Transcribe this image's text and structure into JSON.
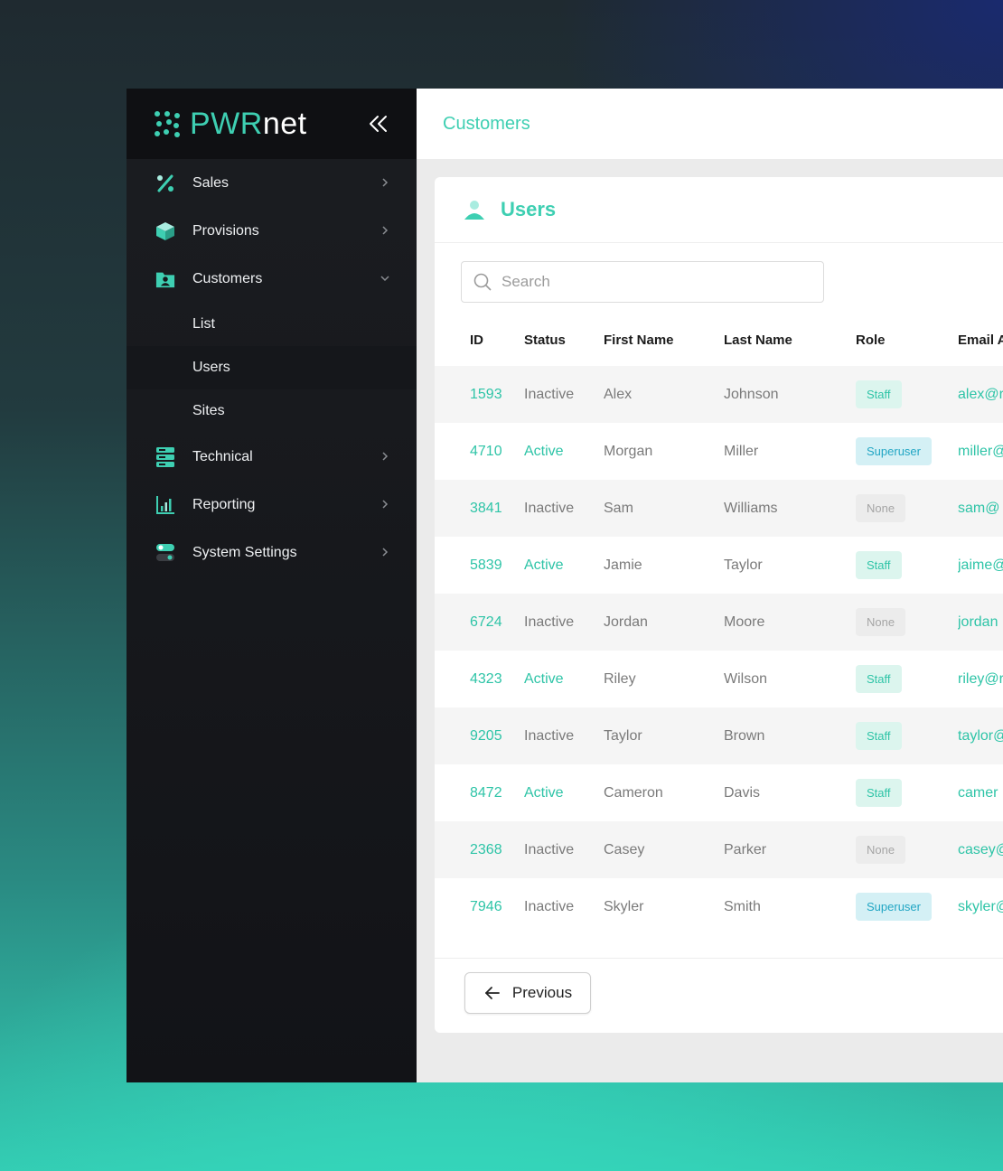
{
  "brand": {
    "name_part1": "PWR",
    "name_part2": "net"
  },
  "colors": {
    "accent": "#3ecfb2",
    "sidebar_bg": "#16181c",
    "superuser": "#22a6c4"
  },
  "sidebar": {
    "items": [
      {
        "label": "Sales",
        "icon": "percent-icon"
      },
      {
        "label": "Provisions",
        "icon": "cube-icon"
      },
      {
        "label": "Customers",
        "icon": "folder-user-icon",
        "expanded": true,
        "children": [
          {
            "label": "List"
          },
          {
            "label": "Users",
            "active": true
          },
          {
            "label": "Sites"
          }
        ]
      },
      {
        "label": "Technical",
        "icon": "server-icon"
      },
      {
        "label": "Reporting",
        "icon": "bar-chart-icon"
      },
      {
        "label": "System Settings",
        "icon": "toggle-icon"
      }
    ]
  },
  "topbar": {
    "title": "Customers"
  },
  "card": {
    "title": "Users",
    "search_placeholder": "Search",
    "columns": [
      "ID",
      "Status",
      "First Name",
      "Last Name",
      "Role",
      "Email A"
    ],
    "rows": [
      {
        "id": "1593",
        "status": "Inactive",
        "first": "Alex",
        "last": "Johnson",
        "role": "Staff",
        "email": "alex@r"
      },
      {
        "id": "4710",
        "status": "Active",
        "first": "Morgan",
        "last": "Miller",
        "role": "Superuser",
        "email": "miller@"
      },
      {
        "id": "3841",
        "status": "Inactive",
        "first": "Sam",
        "last": "Williams",
        "role": "None",
        "email": "sam@"
      },
      {
        "id": "5839",
        "status": "Active",
        "first": "Jamie",
        "last": "Taylor",
        "role": "Staff",
        "email": "jaime@"
      },
      {
        "id": "6724",
        "status": "Inactive",
        "first": "Jordan",
        "last": "Moore",
        "role": "None",
        "email": "jordan"
      },
      {
        "id": "4323",
        "status": "Active",
        "first": "Riley",
        "last": "Wilson",
        "role": "Staff",
        "email": "riley@r"
      },
      {
        "id": "9205",
        "status": "Inactive",
        "first": "Taylor",
        "last": "Brown",
        "role": "Staff",
        "email": "taylor@"
      },
      {
        "id": "8472",
        "status": "Active",
        "first": "Cameron",
        "last": "Davis",
        "role": "Staff",
        "email": "camer"
      },
      {
        "id": "2368",
        "status": "Inactive",
        "first": "Casey",
        "last": "Parker",
        "role": "None",
        "email": "casey@"
      },
      {
        "id": "7946",
        "status": "Inactive",
        "first": "Skyler",
        "last": "Smith",
        "role": "Superuser",
        "email": "skyler@"
      }
    ],
    "prev_label": "Previous"
  }
}
